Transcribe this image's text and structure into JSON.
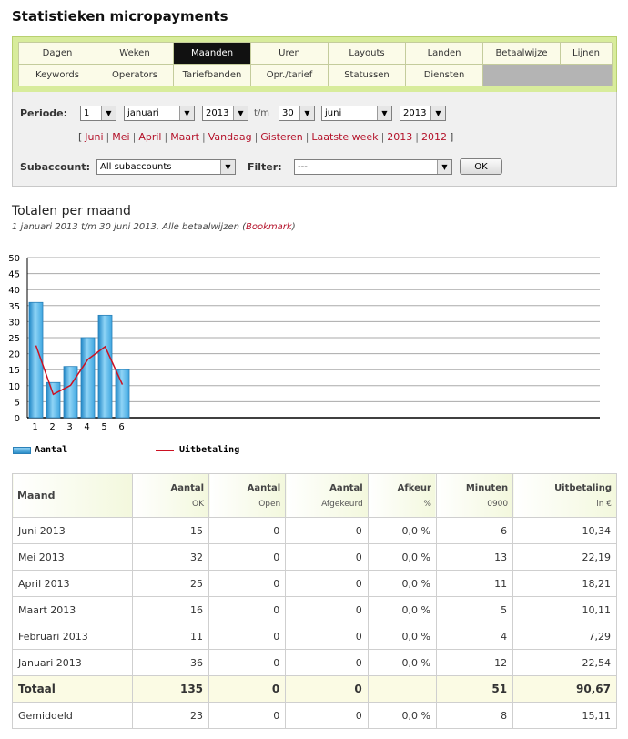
{
  "page_title": "Statistieken micropayments",
  "nav": {
    "tabs": [
      {
        "label": "Dagen",
        "active": false
      },
      {
        "label": "Weken",
        "active": false
      },
      {
        "label": "Maanden",
        "active": true
      },
      {
        "label": "Uren",
        "active": false
      },
      {
        "label": "Layouts",
        "active": false
      },
      {
        "label": "Landen",
        "active": false
      },
      {
        "label": "Betaalwijze",
        "active": false
      },
      {
        "label": "Lijnen",
        "active": false
      },
      {
        "label": "Keywords",
        "active": false
      },
      {
        "label": "Operators",
        "active": false
      },
      {
        "label": "Tariefbanden",
        "active": false
      },
      {
        "label": "Opr./tarief",
        "active": false
      },
      {
        "label": "Statussen",
        "active": false
      },
      {
        "label": "Diensten",
        "active": false
      }
    ]
  },
  "filter": {
    "periode_label": "Periode:",
    "from_day": "1",
    "from_month": "januari",
    "from_year": "2013",
    "tm_label": "t/m",
    "to_day": "30",
    "to_month": "juni",
    "to_year": "2013",
    "quick_links": [
      "Juni",
      "Mei",
      "April",
      "Maart",
      "Vandaag",
      "Gisteren",
      "Laatste week",
      "2013",
      "2012"
    ],
    "quick_open": "[",
    "quick_close": "]",
    "quick_sep": "|",
    "subaccount_label": "Subaccount:",
    "subaccount_value": "All subaccounts",
    "filter_label": "Filter:",
    "filter_value": "---",
    "ok_label": "OK"
  },
  "section": {
    "title": "Totalen per maand",
    "subtitle": "1 januari 2013 t/m 30 juni 2013, Alle betaalwijzen",
    "bookmark_open": "(",
    "bookmark": "Bookmark",
    "bookmark_close": ")"
  },
  "colors": {
    "bar": "#3ea6e0",
    "line": "#cc1122",
    "accent_green": "#d8ec9c",
    "link_red": "#b4122a"
  },
  "chart_data": {
    "type": "bar",
    "categories": [
      "1",
      "2",
      "3",
      "4",
      "5",
      "6"
    ],
    "ylim": [
      0,
      50
    ],
    "yticks": [
      0,
      5,
      10,
      15,
      20,
      25,
      30,
      35,
      40,
      45,
      50
    ],
    "grid": true,
    "legend_position": "bottom-left",
    "series": [
      {
        "name": "Aantal",
        "kind": "bar",
        "values": [
          36,
          11,
          16,
          25,
          32,
          15
        ]
      },
      {
        "name": "Uitbetaling",
        "kind": "line",
        "values": [
          22.54,
          7.29,
          10.11,
          18.21,
          22.19,
          10.34
        ]
      }
    ]
  },
  "table": {
    "headers": [
      {
        "line1": "Maand",
        "line2": ""
      },
      {
        "line1": "Aantal",
        "line2": "OK"
      },
      {
        "line1": "Aantal",
        "line2": "Open"
      },
      {
        "line1": "Aantal",
        "line2": "Afgekeurd"
      },
      {
        "line1": "Afkeur",
        "line2": "%"
      },
      {
        "line1": "Minuten",
        "line2": "0900"
      },
      {
        "line1": "Uitbetaling",
        "line2": "in €"
      }
    ],
    "rows": [
      [
        "Juni 2013",
        "15",
        "0",
        "0",
        "0,0 %",
        "6",
        "10,34"
      ],
      [
        "Mei 2013",
        "32",
        "0",
        "0",
        "0,0 %",
        "13",
        "22,19"
      ],
      [
        "April 2013",
        "25",
        "0",
        "0",
        "0,0 %",
        "11",
        "18,21"
      ],
      [
        "Maart 2013",
        "16",
        "0",
        "0",
        "0,0 %",
        "5",
        "10,11"
      ],
      [
        "Februari 2013",
        "11",
        "0",
        "0",
        "0,0 %",
        "4",
        "7,29"
      ],
      [
        "Januari 2013",
        "36",
        "0",
        "0",
        "0,0 %",
        "12",
        "22,54"
      ]
    ],
    "total": [
      "Totaal",
      "135",
      "0",
      "0",
      "",
      "51",
      "90,67"
    ],
    "average": [
      "Gemiddeld",
      "23",
      "0",
      "0",
      "0,0 %",
      "8",
      "15,11"
    ]
  }
}
